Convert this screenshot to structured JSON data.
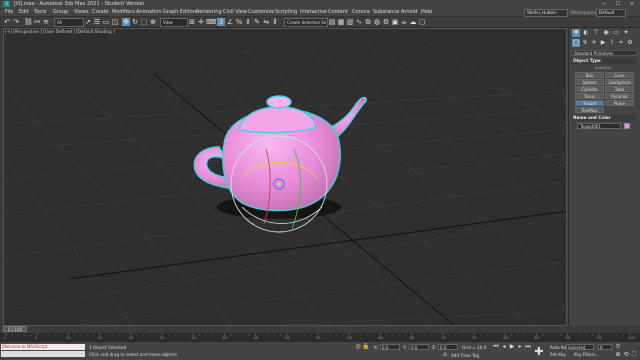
{
  "window": {
    "title": "[ill].max - Autodesk 3ds Max 2021 - Student Version",
    "app_icon": "3"
  },
  "menus": [
    "File",
    "Edit",
    "Tools",
    "Group",
    "Views",
    "Create",
    "Modifiers",
    "Animation",
    "Graph Editors",
    "Rendering",
    "Civil View",
    "Customize",
    "Scripting",
    "Interactive",
    "Content",
    "Corona",
    "Substance",
    "Arnold",
    "Help"
  ],
  "account": {
    "user": "Wolfei_Hubbin",
    "workspaces_label": "Workspaces:",
    "workspace": "Default"
  },
  "toolbar": {
    "selection_filter": "All",
    "view_dropdown": "View",
    "named_selection": "Create Selection Se"
  },
  "viewport": {
    "label": "[+] [Perspective ] [User Defined ] [Default Shading ]"
  },
  "command_panel": {
    "category_dropdown": "Standard Primitives",
    "object_type_title": "Object Type",
    "autogrid_label": "AutoGrid",
    "object_buttons": [
      "Box",
      "Cone",
      "Sphere",
      "GeoSphere",
      "Cylinder",
      "Tube",
      "Torus",
      "Pyramid",
      "Teapot",
      "Plane",
      "TextPlus"
    ],
    "name_color_title": "Name and Color",
    "object_name": "Teapot001",
    "object_color": "#f08ee0"
  },
  "timeline": {
    "slider": "0 / 100",
    "ticks": [
      "0",
      "5",
      "10",
      "15",
      "20",
      "25",
      "30",
      "35",
      "40",
      "45",
      "50",
      "55",
      "60",
      "65",
      "70",
      "75",
      "80",
      "85",
      "90",
      "95",
      "100"
    ]
  },
  "status": {
    "maxscript": "Welcome to MAXScript.",
    "selection_status": "1 Object Selected",
    "prompt": "Click and drag to select and move objects",
    "x_label": "X:",
    "x_value": "0.0",
    "y_label": "Y:",
    "y_value": "0.0",
    "z_label": "Z:",
    "z_value": "0.0",
    "grid": "Grid = 10.0",
    "add_time_tag": "Add Time Tag",
    "auto_key": "Auto Key",
    "key_filter": "Selected",
    "set_key": "Set Key",
    "key_filters": "Key Filters...",
    "frame": "0"
  }
}
